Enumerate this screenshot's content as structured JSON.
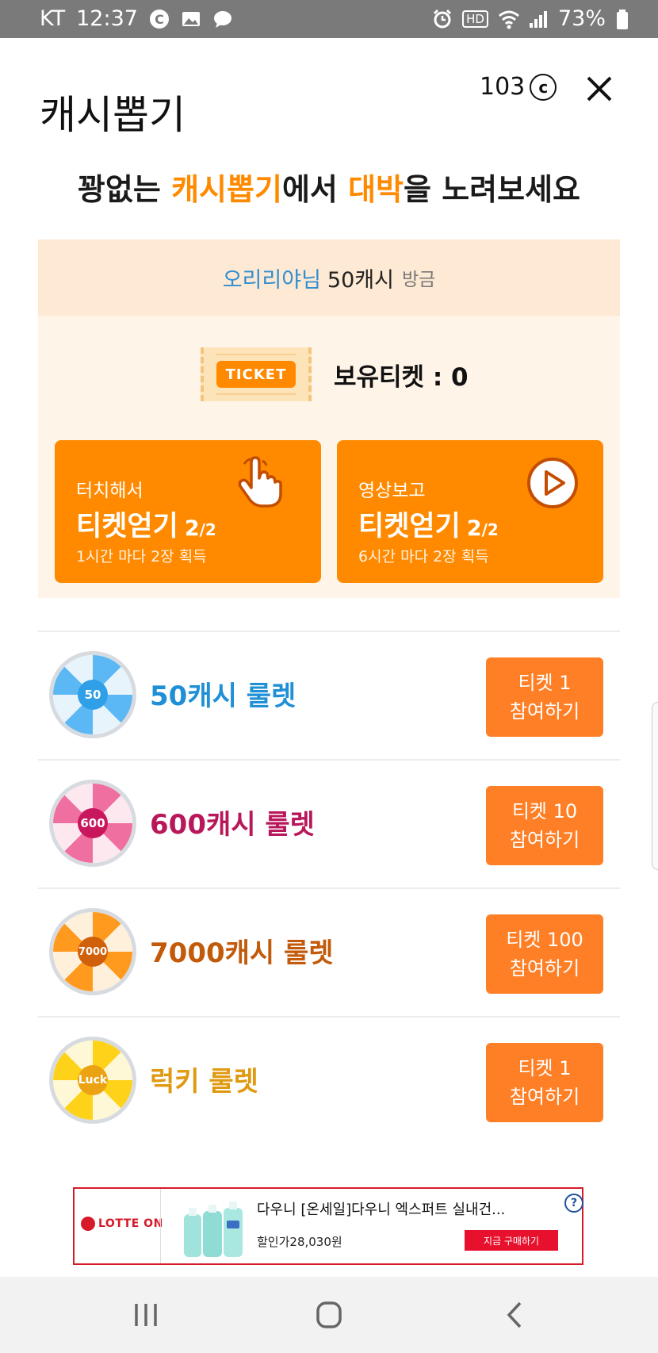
{
  "status_bar": {
    "carrier": "KT",
    "time": "12:37",
    "hd_label": "HD",
    "battery": "73%",
    "icons": [
      "c-circle-icon",
      "gallery-icon",
      "chat-bubble-icon",
      "alarm-icon",
      "hd-icon",
      "wifi-icon",
      "signal-icon",
      "battery-icon"
    ]
  },
  "header": {
    "title": "캐시뽑기",
    "coin_balance": "103",
    "coin_symbol": "c"
  },
  "headline": {
    "part1": "꽝없는 ",
    "highlight1": "캐시뽑기",
    "part2": "에서 ",
    "highlight2": "대박",
    "part3": "을 노려보세요"
  },
  "winner_banner": {
    "name": "오리리야님",
    "amount": "50캐시",
    "time": "방금"
  },
  "tickets": {
    "tag": "TICKET",
    "label": "보유티켓 : 0"
  },
  "ticket_buttons": [
    {
      "small": "터치해서",
      "big": "티켓얻기",
      "frac_num": "2",
      "frac_den": "2",
      "note": "1시간 마다 2장 획득",
      "icon": "hand-pointer-icon"
    },
    {
      "small": "영상보고",
      "big": "티켓얻기",
      "frac_num": "2",
      "frac_den": "2",
      "note": "6시간 마다 2장 획득",
      "icon": "play-icon"
    }
  ],
  "roulettes": [
    {
      "center": "50",
      "label": "50캐시 룰렛",
      "ticket": "티켓 1",
      "join": "참여하기",
      "color": "#1f8fd6",
      "wheel_a": "#5bb8f5",
      "wheel_b": "#e8f4fc",
      "wheel_center": "#2f9fe8"
    },
    {
      "center": "600",
      "label": "600캐시 룰렛",
      "ticket": "티켓 10",
      "join": "참여하기",
      "color": "#b8185a",
      "wheel_a": "#ef6fa0",
      "wheel_b": "#fde8ef",
      "wheel_center": "#c9175e"
    },
    {
      "center": "7000",
      "label": "7000캐시 룰렛",
      "ticket": "티켓 100",
      "join": "참여하기",
      "color": "#c25a0a",
      "wheel_a": "#ff9a1f",
      "wheel_b": "#fff0dc",
      "wheel_center": "#d0600a"
    },
    {
      "center": "Luck",
      "label": "럭키 룰렛",
      "ticket": "티켓 1",
      "join": "참여하기",
      "color": "#e09a12",
      "wheel_a": "#ffd21a",
      "wheel_b": "#fff8d6",
      "wheel_center": "#eba314"
    }
  ],
  "ad": {
    "brand": "LOTTE ON",
    "title": "다우니 [온세일]다우니 엑스퍼트 실내건...",
    "price": "할인가28,030원",
    "cta": "지금 구매하기",
    "info": "?"
  },
  "colors": {
    "accent": "#ff8a00",
    "join_button": "#ff7f26",
    "status_bar": "#7a7a7a"
  },
  "nav": {
    "icons": [
      "recent-apps-icon",
      "home-icon",
      "back-icon"
    ]
  }
}
